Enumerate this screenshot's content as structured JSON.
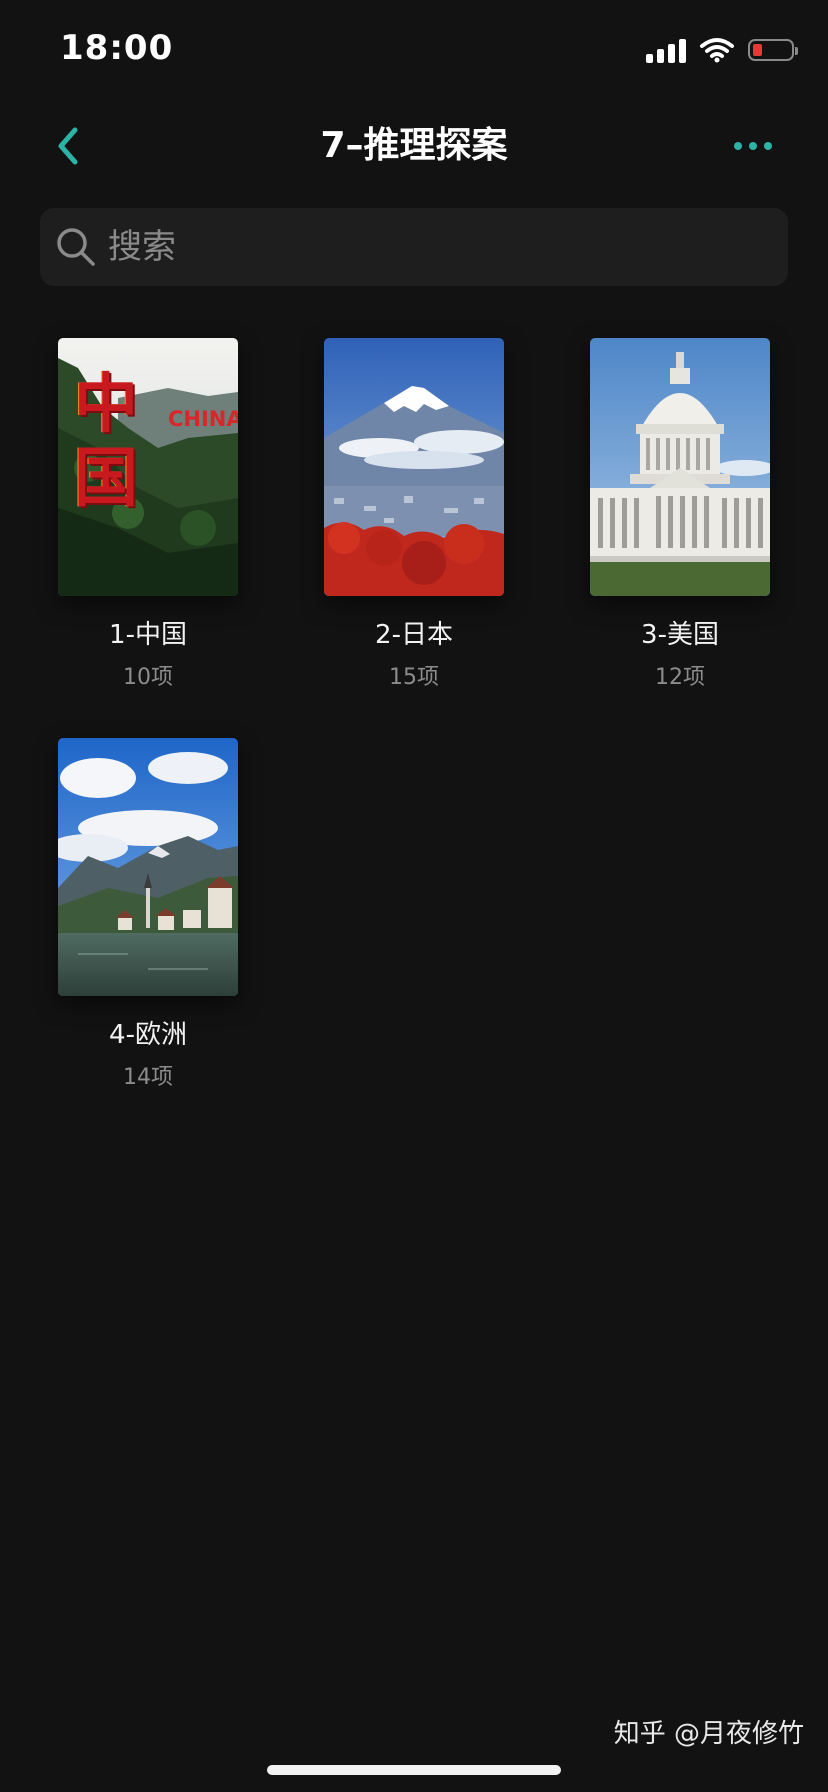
{
  "status_bar": {
    "time": "18:00",
    "battery_color": "#e53935"
  },
  "nav": {
    "title": "7–推理探案",
    "accent_color": "#2bb3a6",
    "back_icon": "chevron-left-icon",
    "more_icon": "more-horizontal-icon"
  },
  "search": {
    "placeholder": "搜索",
    "value": ""
  },
  "albums": [
    {
      "name": "1-中国",
      "count": "10项",
      "cover_text": "中国",
      "cover_subtext": "CHINA"
    },
    {
      "name": "2-日本",
      "count": "15项"
    },
    {
      "name": "3-美国",
      "count": "12项"
    },
    {
      "name": "4-欧洲",
      "count": "14项"
    }
  ],
  "watermark": "知乎 @月夜修竹"
}
